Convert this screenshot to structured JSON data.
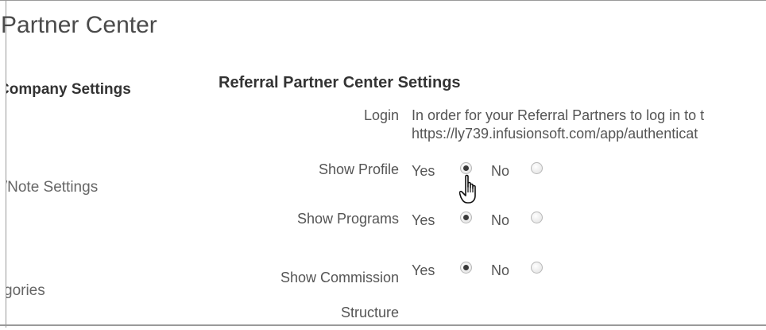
{
  "page": {
    "title": "l Partner Center"
  },
  "sidebar": {
    "items": [
      {
        "label": "Company Settings"
      },
      {
        "label": "ot/Note Settings"
      },
      {
        "label": "gories"
      }
    ]
  },
  "main": {
    "heading": "Referral Partner Center Settings",
    "login": {
      "label": "Login",
      "line1": "In order for your Referral Partners to log in to t",
      "line2": "https://ly739.infusionsoft.com/app/authenticat"
    },
    "settings": [
      {
        "label": "Show Profile",
        "yes": "Yes",
        "no": "No",
        "selected": "Yes"
      },
      {
        "label": "Show Programs",
        "yes": "Yes",
        "no": "No",
        "selected": "Yes"
      },
      {
        "label": "Show Commission Structure",
        "yes": "Yes",
        "no": "No",
        "selected": "Yes"
      }
    ]
  },
  "icons": {
    "cursor": "hand-pointer-icon",
    "radio": "radio-button-icon"
  }
}
